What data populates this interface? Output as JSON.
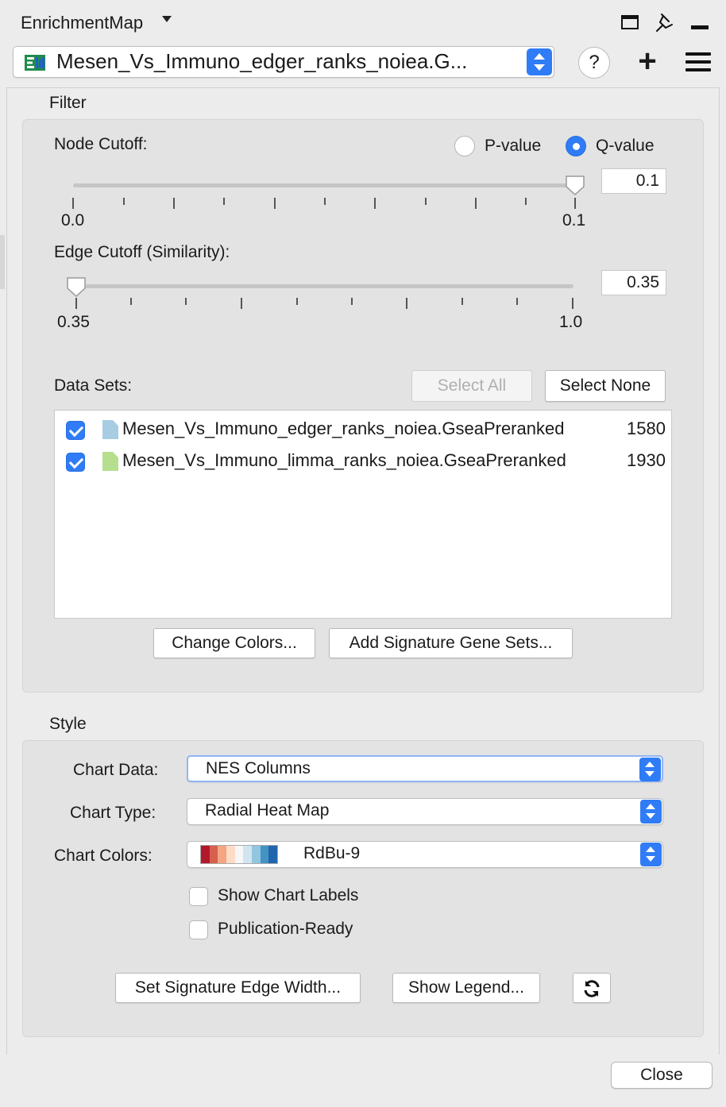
{
  "titlebar": {
    "title": "EnrichmentMap"
  },
  "network_select": {
    "value": "Mesen_Vs_Immuno_edger_ranks_noiea.G..."
  },
  "toolbar": {
    "help_label": "?",
    "add_label": "+"
  },
  "filter": {
    "section_label": "Filter",
    "node_cutoff_label": "Node Cutoff:",
    "pvalue_label": "P-value",
    "qvalue_label": "Q-value",
    "selected_metric": "Q-value",
    "node_slider": {
      "min_label": "0.0",
      "max_label": "0.1",
      "min": 0.0,
      "max": 0.1,
      "value": 0.1
    },
    "node_value": "0.1",
    "edge_cutoff_label": "Edge Cutoff (Similarity):",
    "edge_slider": {
      "min_label": "0.35",
      "max_label": "1.0",
      "min": 0.35,
      "max": 1.0,
      "value": 0.35
    },
    "edge_value": "0.35",
    "datasets_label": "Data Sets:",
    "select_all_label": "Select All",
    "select_none_label": "Select None",
    "datasets": [
      {
        "name": "Mesen_Vs_Immuno_edger_ranks_noiea.GseaPreranked",
        "count": "1580",
        "checked": true,
        "color": "#a8cde3"
      },
      {
        "name": "Mesen_Vs_Immuno_limma_ranks_noiea.GseaPreranked",
        "count": "1930",
        "checked": true,
        "color": "#b5df8f"
      }
    ],
    "change_colors_label": "Change Colors...",
    "add_signature_label": "Add Signature Gene Sets..."
  },
  "style": {
    "section_label": "Style",
    "chart_data_label": "Chart Data:",
    "chart_data_value": "NES Columns",
    "chart_type_label": "Chart Type:",
    "chart_type_value": "Radial Heat Map",
    "chart_colors_label": "Chart Colors:",
    "chart_colors_value": "RdBu-9",
    "palette": [
      "#b2182b",
      "#d6604d",
      "#f4a582",
      "#fddbc7",
      "#f7f7f7",
      "#d1e5f0",
      "#92c5de",
      "#4393c3",
      "#2166ac"
    ],
    "show_chart_labels": "Show Chart Labels",
    "publication_ready": "Publication-Ready",
    "set_edge_width_label": "Set Signature Edge Width...",
    "show_legend_label": "Show Legend..."
  },
  "footer": {
    "close_label": "Close"
  },
  "colors": {
    "accent": "#2f7cf6"
  }
}
